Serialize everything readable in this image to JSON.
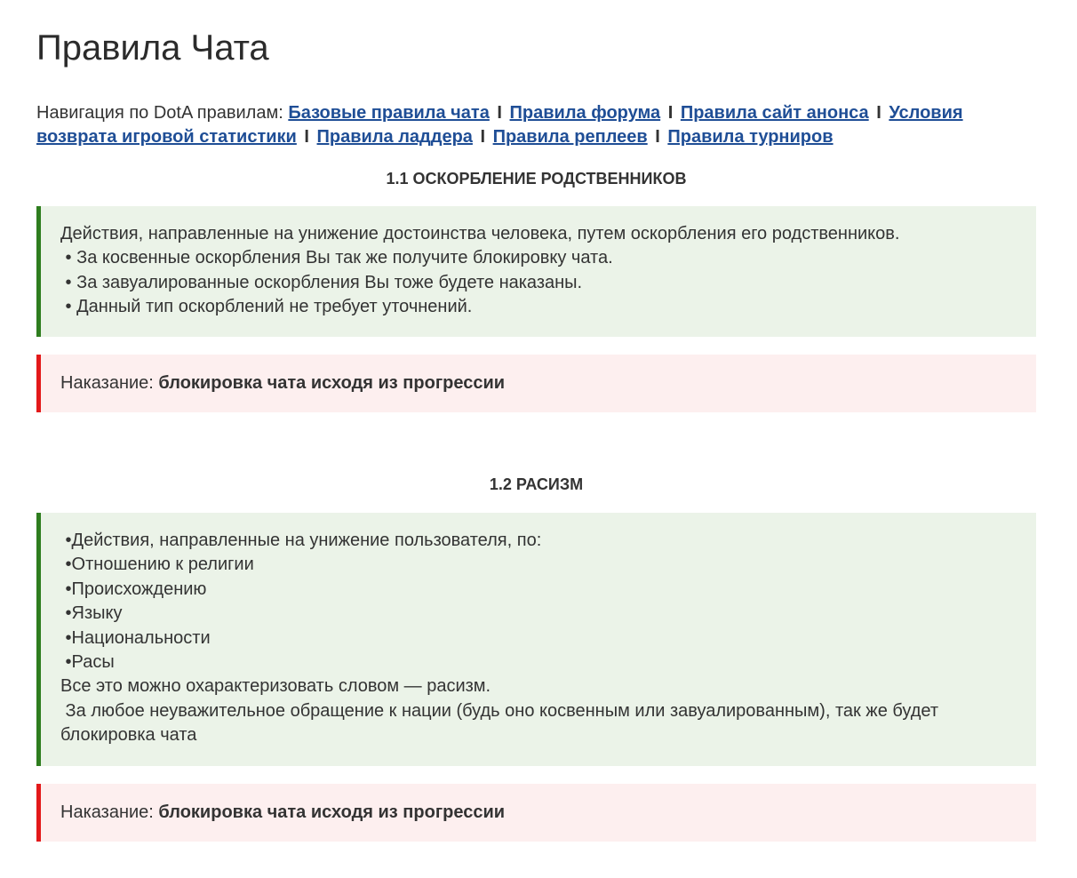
{
  "page": {
    "title": "Правила Чата"
  },
  "navigation": {
    "prefix": "Навигация по DotA правилам:",
    "separator": "I",
    "links": [
      {
        "label": "Базовые правила чата"
      },
      {
        "label": "Правила форума"
      },
      {
        "label": "Правила сайт анонса"
      },
      {
        "label": "Условия возврата игровой статистики"
      },
      {
        "label": "Правила ладдера"
      },
      {
        "label": "Правила реплеев"
      },
      {
        "label": "Правила турниров"
      }
    ],
    "link_color": "#1f4e96"
  },
  "sections": [
    {
      "title": "1.1 ОСКОРБЛЕНИЕ РОДСТВЕННИКОВ",
      "lines": [
        "Действия, направленные на унижение достоинства человека, путем оскорбления его родственников.",
        " • За косвенные оскорбления Вы так же получите блокировку чата.",
        " • За завуалированные оскорбления Вы тоже будете наказаны.",
        " • Данный тип оскорблений не требует уточнений."
      ],
      "penalty_label": "Наказание:",
      "penalty_value": "блокировка чата исходя из прогрессии"
    },
    {
      "title": "1.2 РАСИЗМ",
      "lines": [
        " •Действия, направленные на унижение пользователя, по:",
        " •Отношению к религии",
        " •Происхождению",
        " •Языку",
        " •Национальности",
        " •Расы",
        "Все это можно охарактеризовать словом — расизм.",
        " За любое неуважительное обращение к нации (будь оно косвенным или завуалированным), так же будет",
        "блокировка чата"
      ],
      "penalty_label": "Наказание:",
      "penalty_value": "блокировка чата исходя из прогрессии"
    }
  ],
  "colors": {
    "rule_box_bg": "#ebf3e8",
    "rule_box_border": "#2e7d1e",
    "penalty_box_bg": "#fdefef",
    "penalty_box_border": "#e3191a"
  }
}
